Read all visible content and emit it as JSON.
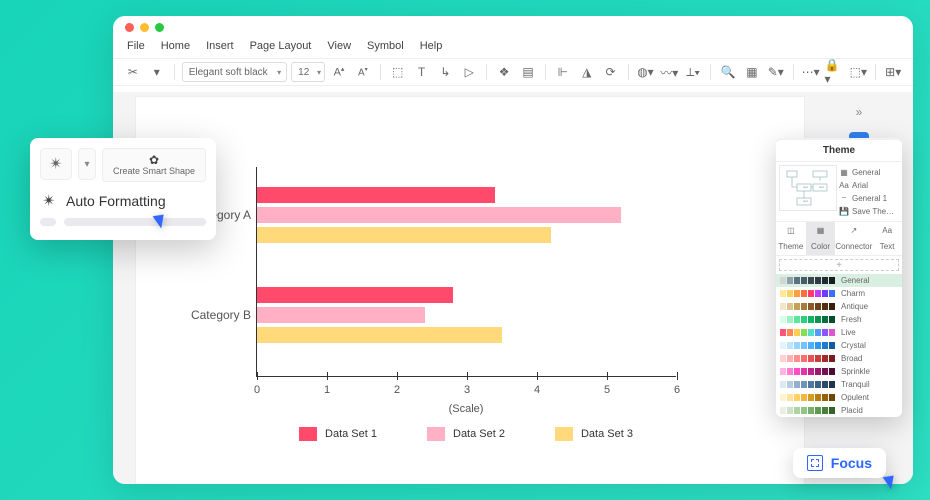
{
  "menus": [
    "File",
    "Home",
    "Insert",
    "Page Layout",
    "View",
    "Symbol",
    "Help"
  ],
  "toolbar": {
    "font_name": "Elegant soft black",
    "font_size": "12"
  },
  "chart_data": {
    "type": "bar",
    "orientation": "horizontal",
    "categories": [
      "Category A",
      "Category B"
    ],
    "series": [
      {
        "name": "Data Set 1",
        "color": "#ff4a6b",
        "values": [
          3.4,
          2.8
        ]
      },
      {
        "name": "Data Set 2",
        "color": "#ffb0c4",
        "values": [
          5.2,
          2.4
        ]
      },
      {
        "name": "Data Set 3",
        "color": "#ffd97a",
        "values": [
          4.2,
          3.5
        ]
      }
    ],
    "xlabel": "(Scale)",
    "xlim": [
      0,
      6
    ],
    "xticks": [
      0,
      1,
      2,
      3,
      4,
      5,
      6
    ]
  },
  "theme_panel": {
    "title": "Theme",
    "props": [
      {
        "icon": "grid",
        "label": "General"
      },
      {
        "icon": "Aa",
        "label": "Arial"
      },
      {
        "icon": "line",
        "label": "General 1"
      },
      {
        "icon": "save",
        "label": "Save The…"
      }
    ],
    "tabs": [
      "Theme",
      "Color",
      "Connector",
      "Text"
    ],
    "active_tab": "Color",
    "palettes": [
      {
        "name": "General",
        "colors": [
          "#d0d5d8",
          "#90a0aa",
          "#5c7080",
          "#4a5a69",
          "#3c4752",
          "#2f3943",
          "#232a31",
          "#171c21"
        ]
      },
      {
        "name": "Charm",
        "colors": [
          "#ffe79b",
          "#ffd25f",
          "#ff9f43",
          "#ff6f3c",
          "#ff3c6f",
          "#c43cff",
          "#6f3cff",
          "#3c6fff"
        ]
      },
      {
        "name": "Antique",
        "colors": [
          "#f2e5c9",
          "#dcc48e",
          "#c4a15a",
          "#a97b3b",
          "#8a5a27",
          "#6d421b",
          "#513012",
          "#36200b"
        ]
      },
      {
        "name": "Fresh",
        "colors": [
          "#d6ffe8",
          "#9bf2c3",
          "#5ee59d",
          "#28d17a",
          "#12b463",
          "#0c9250",
          "#086f3d",
          "#054c29"
        ]
      },
      {
        "name": "Live",
        "colors": [
          "#ff5577",
          "#ff8855",
          "#ffcc55",
          "#88dd55",
          "#55ddcc",
          "#5599ff",
          "#8855ff",
          "#dd55cc"
        ]
      },
      {
        "name": "Crystal",
        "colors": [
          "#e2f3ff",
          "#bfe4ff",
          "#99d3ff",
          "#73c1ff",
          "#4dafff",
          "#2e97f2",
          "#1f7acc",
          "#145ca0"
        ]
      },
      {
        "name": "Broad",
        "colors": [
          "#ffd0d0",
          "#ffb0b0",
          "#ff8f8f",
          "#ff6e6e",
          "#e85454",
          "#c63e3e",
          "#a02c2c",
          "#781d1d"
        ]
      },
      {
        "name": "Sprinkle",
        "colors": [
          "#ffb3e6",
          "#ff80d4",
          "#ff4dc2",
          "#e633a8",
          "#bf248a",
          "#991a6d",
          "#731250",
          "#4d0b34"
        ]
      },
      {
        "name": "Tranquil",
        "colors": [
          "#dfe9f3",
          "#b8cce0",
          "#93afcd",
          "#7093ba",
          "#5379a3",
          "#3e618a",
          "#2d4a6d",
          "#1e344f"
        ]
      },
      {
        "name": "Opulent",
        "colors": [
          "#fff2cf",
          "#ffe39b",
          "#ffd166",
          "#f4b63e",
          "#d99a23",
          "#b87e14",
          "#93620b",
          "#6e4705"
        ]
      },
      {
        "name": "Placid",
        "colors": [
          "#e8f0e5",
          "#cde2c6",
          "#b0d3a5",
          "#93c485",
          "#78b268",
          "#5f9a51",
          "#48803d",
          "#33652b"
        ]
      }
    ],
    "highlight": "General"
  },
  "auto_format": {
    "smart_label": "Create Smart Shape",
    "title": "Auto Formatting"
  },
  "focus_label": "Focus"
}
